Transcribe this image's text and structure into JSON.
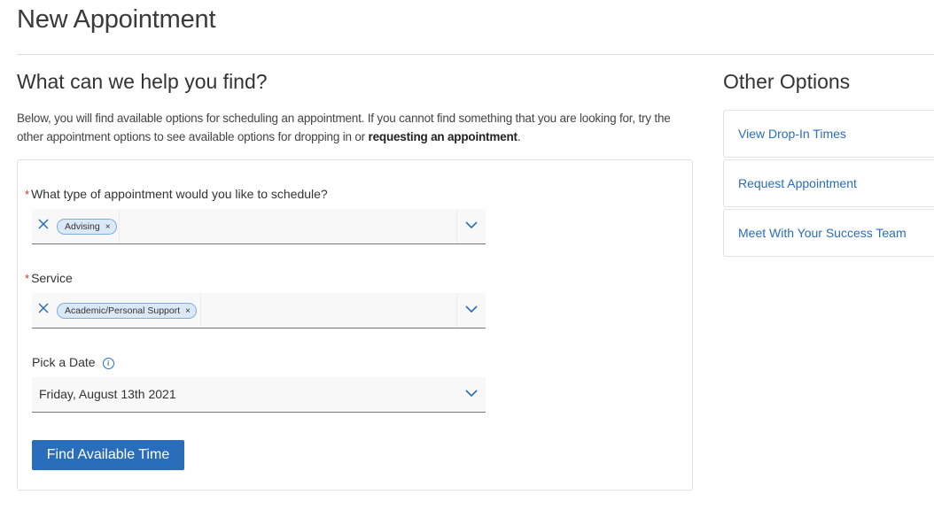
{
  "page": {
    "title": "New Appointment"
  },
  "main": {
    "section_title": "What can we help you find?",
    "intro_text": "Below, you will find available options for scheduling an appointment. If you cannot find something that you are looking for, try the other appointment options to see available options for dropping in or ",
    "intro_bold": "requesting an appointment",
    "intro_end": ".",
    "form": {
      "appointment_type": {
        "label": "What type of appointment would you like to schedule?",
        "required_mark": "*",
        "selected": "Advising",
        "chip_remove": "×"
      },
      "service": {
        "label": "Service",
        "required_mark": "*",
        "selected": "Academic/Personal Support",
        "chip_remove": "×"
      },
      "date": {
        "label": "Pick a Date",
        "info_icon": "i",
        "value": "Friday, August 13th 2021"
      },
      "submit_label": "Find Available Time"
    }
  },
  "sidebar": {
    "title": "Other Options",
    "options": [
      {
        "label": "View Drop-In Times"
      },
      {
        "label": "Request Appointment"
      },
      {
        "label": "Meet With Your Success Team"
      }
    ]
  },
  "colors": {
    "accent": "#2a6ebb",
    "chip_bg": "#dbe9f7",
    "required": "#c0392b"
  }
}
